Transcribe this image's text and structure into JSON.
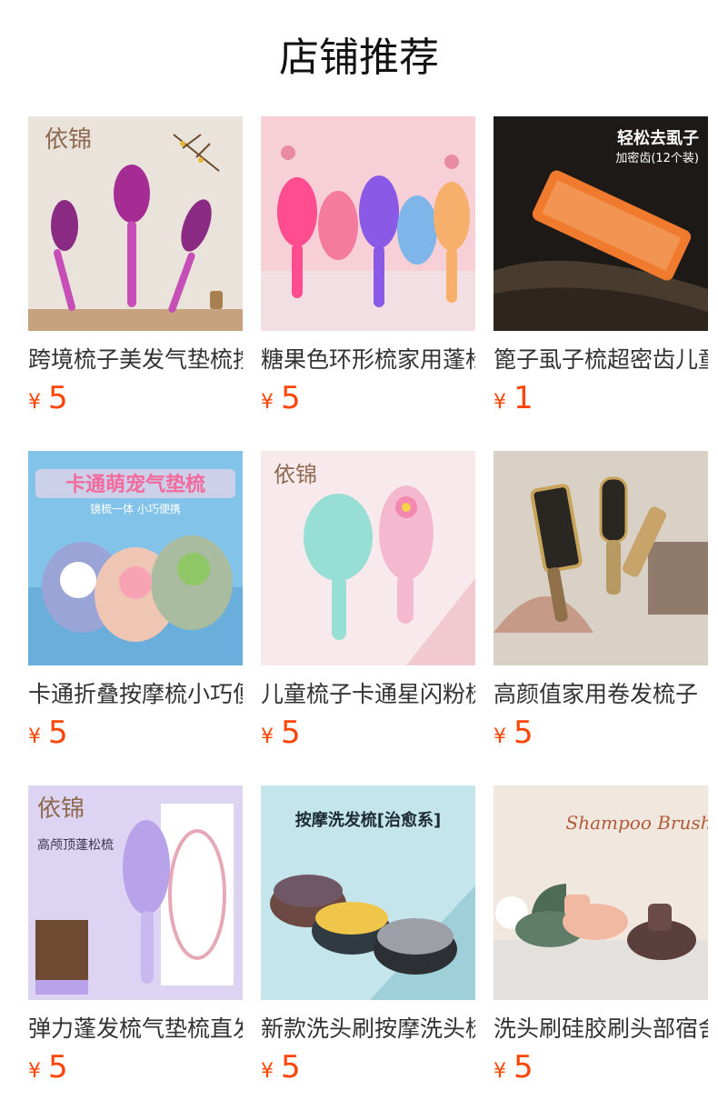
{
  "page": {
    "title": "店铺推荐"
  },
  "products": [
    {
      "name": "跨境梳子美发气垫梳按摩梳",
      "currency": "¥",
      "price": "5",
      "badge": "依锦",
      "image_colors": {
        "bg": "#e7e0d8",
        "accent": "#b43ea8"
      }
    },
    {
      "name": "糖果色环形梳家用蓬松梳",
      "currency": "¥",
      "price": "5",
      "badge": "",
      "image_colors": {
        "bg": "#f6c9d1",
        "accent": "#7d55d6"
      }
    },
    {
      "name": "篦子虱子梳超密齿儿童",
      "currency": "¥",
      "price": "1",
      "badge": "轻松去虱子",
      "subbadge": "加密齿(12个装)",
      "image_colors": {
        "bg": "#1d1a17",
        "accent": "#f07a2e"
      }
    },
    {
      "name": "卡通折叠按摩梳小巧便携",
      "currency": "¥",
      "price": "5",
      "badge": "卡通萌宠气垫梳",
      "subbadge": "镜梳一体 小巧便携",
      "image_colors": {
        "bg": "#7ec0ea",
        "accent": "#f2c7b5"
      }
    },
    {
      "name": "儿童梳子卡通星闪粉梳",
      "currency": "¥",
      "price": "5",
      "badge": "依锦",
      "image_colors": {
        "bg": "#f7e6ea",
        "accent": "#8fd8cf"
      }
    },
    {
      "name": "高颜值家用卷发梳子",
      "currency": "¥",
      "price": "5",
      "badge": "",
      "image_colors": {
        "bg": "#d8cfc4",
        "accent": "#9b7b55"
      }
    },
    {
      "name": "弹力蓬发梳气垫梳直发",
      "currency": "¥",
      "price": "5",
      "badge": "依锦",
      "subbadge": "高颅顶蓬松梳",
      "image_colors": {
        "bg": "#dcd3f2",
        "accent": "#b59ce6"
      }
    },
    {
      "name": "新款洗头刷按摩洗头梳",
      "currency": "¥",
      "price": "5",
      "badge": "按摩洗发梳[治愈系]",
      "image_colors": {
        "bg": "#bfe2ea",
        "accent": "#f0c64a"
      }
    },
    {
      "name": "洗头刷硅胶刷头部宿舍",
      "currency": "¥",
      "price": "5",
      "badge": "Shampoo Brush",
      "image_colors": {
        "bg": "#efe6dc",
        "accent": "#5f7d68"
      }
    }
  ]
}
